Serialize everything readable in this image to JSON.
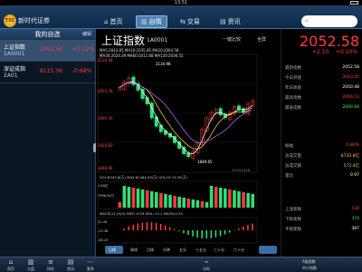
{
  "status": {
    "time": "13:51"
  },
  "app": {
    "name": "新时代证券",
    "logo_text": "TSC"
  },
  "nav": {
    "tabs": [
      {
        "label": "首页",
        "icon": "home-icon",
        "glyph": "⌂"
      },
      {
        "label": "自情",
        "icon": "chart-icon",
        "glyph": "▥",
        "active": true
      },
      {
        "label": "交易",
        "icon": "trade-icon",
        "glyph": "⇆"
      },
      {
        "label": "资讯",
        "icon": "news-icon",
        "glyph": "▤"
      }
    ],
    "search_placeholder": "股票代码/简拼"
  },
  "sidebar": {
    "title": "我的自选",
    "edit_label": "编辑",
    "items": [
      {
        "name": "上证指数",
        "code": "1A0001",
        "price": "2052.58",
        "pct": "+0.12%"
      },
      {
        "name": "深证成指",
        "code": "2A01",
        "price": "8115.36",
        "pct": "-0.68%"
      }
    ]
  },
  "chart_header": {
    "title": "上证指数",
    "code": "1A0001",
    "tools": [
      "一键比较",
      "全屏"
    ],
    "ma_line1": "MA5:2043.85  MA10:2035.85  MA20:2004.58",
    "ma_line2": "MA30:2024.29  MA60:2011.68  MA120:2036.51",
    "high_label": "2134.98",
    "low_label": "1849.65",
    "date_label": "2013/10/18",
    "vol_line": "VOL:8343.8(万)  MA5:81464.93(万)  VOL10:74.55(万)",
    "macd_line": "MACD(12,26,9)  DIFF:-9.09  DEA:-13.1  MACD:4.55"
  },
  "chart_data": {
    "type": "line",
    "title": "上证指数",
    "ylim": [
      1800,
      2200
    ],
    "y_ticks": [
      "2134.98",
      "2063.28",
      "1991.59",
      "1919.83",
      "1848.08"
    ],
    "candles": [
      2100,
      2120,
      2134,
      2110,
      2090,
      2060,
      2040,
      1990,
      1960,
      1940,
      1930,
      1920,
      1900,
      1880,
      1860,
      1850,
      1870,
      1900,
      1950,
      1990,
      2010,
      2020,
      2000,
      1990,
      2010,
      2030,
      2020,
      2010,
      2040,
      2052
    ],
    "volume_ticks": [
      "1.60亿",
      "7996.54万"
    ],
    "macd_ticks": [
      "21.46",
      "-23.38",
      "-68.23"
    ]
  },
  "quote": {
    "price": "2052.58",
    "change": "+2.10",
    "change_pct": "+0.10%",
    "rows": [
      {
        "label": "最新指数",
        "value": "2052.58"
      },
      {
        "label": "今日开盘",
        "value": "2043.45"
      },
      {
        "label": "昨日收盘",
        "value": "2050.48"
      },
      {
        "label": "最高指数",
        "value": "2056.23"
      },
      {
        "label": "最低指数",
        "value": "2040.68"
      },
      {
        "label": "振幅",
        "value": "0.80%"
      },
      {
        "label": "总成交量",
        "value": "6732.8亿"
      },
      {
        "label": "总成交额",
        "value": "572.4亿"
      },
      {
        "label": "量比",
        "value": "0.97"
      },
      {
        "label": "上涨家数",
        "value": "534"
      },
      {
        "label": "下跌家数",
        "value": "374"
      },
      {
        "label": "平盘家数",
        "value": "387"
      }
    ],
    "footer": [
      "A股指数",
      "中小指数"
    ]
  },
  "chart_tabs": [
    "日线",
    "周线",
    "月线",
    "分钟",
    "五分",
    "十五分",
    "三十分",
    "六十分"
  ],
  "bottom_nav": [
    {
      "label": "首页",
      "icon": "home-icon",
      "glyph": "⌂"
    },
    {
      "label": "大盘",
      "icon": "index-icon",
      "glyph": "▥"
    },
    {
      "label": "排名",
      "icon": "rank-icon",
      "glyph": "≡"
    },
    {
      "label": "资讯",
      "icon": "news-icon",
      "glyph": "▤"
    },
    {
      "label": "更多",
      "icon": "more-icon",
      "glyph": "⋯"
    }
  ],
  "footer_right": {
    "label": "分时"
  }
}
